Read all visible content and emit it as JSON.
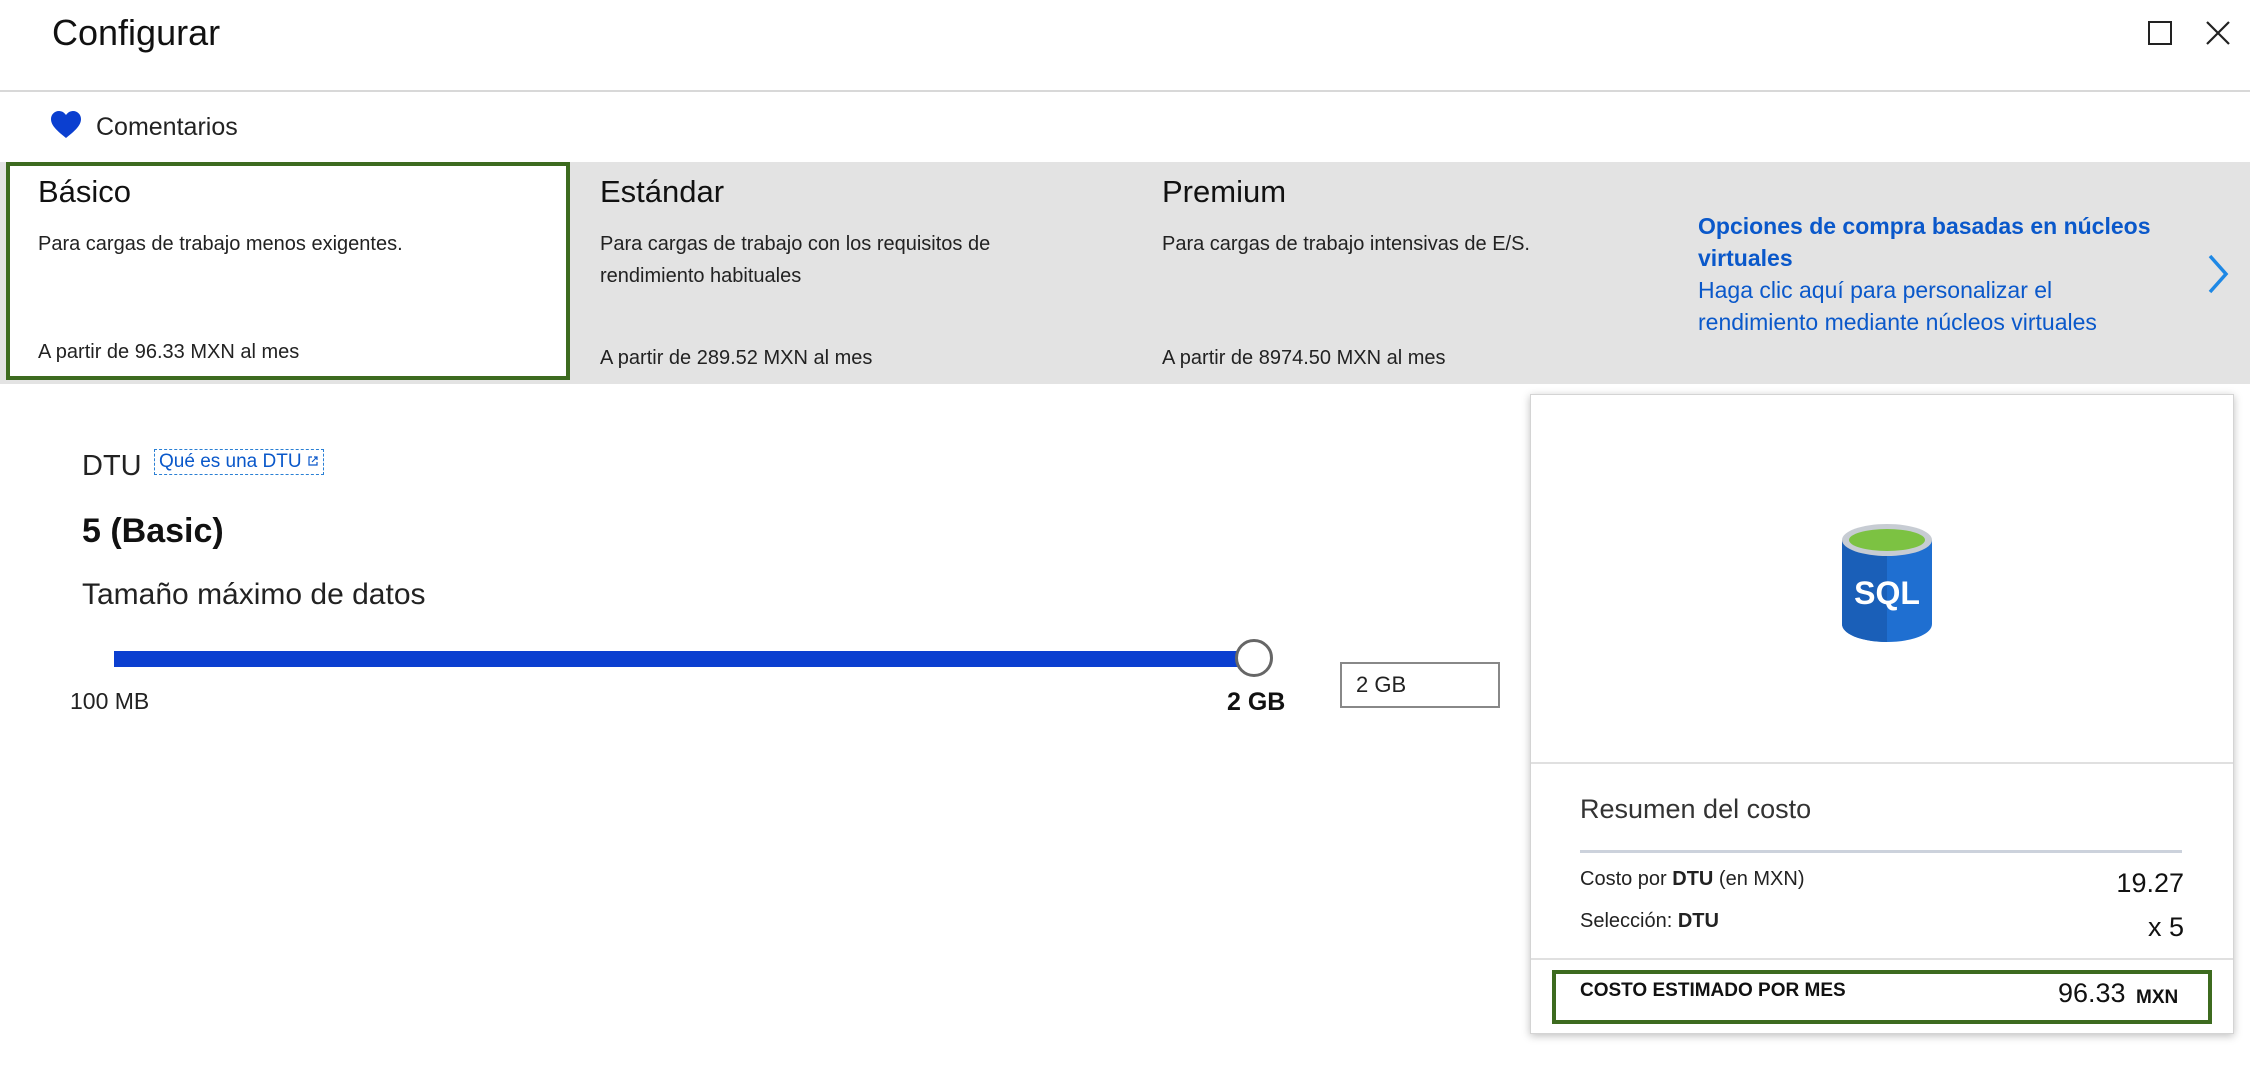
{
  "header": {
    "title": "Configurar",
    "maximize_icon": "maximize-icon",
    "close_icon": "close-icon"
  },
  "feedback": {
    "label": "Comentarios",
    "icon": "heart-icon",
    "icon_color": "#0b3fd0"
  },
  "tiers": [
    {
      "name": "Básico",
      "description": "Para cargas de trabajo menos exigentes.",
      "price": "A partir de 96.33 MXN al mes",
      "selected": true
    },
    {
      "name": "Estándar",
      "description": "Para cargas de trabajo con los requisitos de rendimiento habituales",
      "price": "A partir de 289.52 MXN al mes",
      "selected": false
    },
    {
      "name": "Premium",
      "description": "Para cargas de trabajo intensivas de E/S.",
      "price": "A partir de 8974.50 MXN al mes",
      "selected": false
    }
  ],
  "vcore": {
    "title": "Opciones de compra basadas en núcleos virtuales",
    "description": "Haga clic aquí para personalizar el rendimiento mediante núcleos virtuales",
    "icon": "chevron-right-icon"
  },
  "dtu": {
    "label": "DTU",
    "link": "Qué es una DTU",
    "value": "5 (Basic)"
  },
  "max_size": {
    "label": "Tamaño máximo de datos",
    "min_label": "100 MB",
    "max_label": "2 GB",
    "input_value": "2 GB",
    "slider_fraction": 1.0
  },
  "cost_summary": {
    "icon": "sql-database-icon",
    "icon_text": "SQL",
    "title": "Resumen del costo",
    "rows": [
      {
        "label_prefix": "Costo por ",
        "label_bold": "DTU",
        "label_suffix": " (en MXN)",
        "value": "19.27"
      },
      {
        "label_prefix": "Selección: ",
        "label_bold": "DTU",
        "label_suffix": "",
        "value": "x 5"
      }
    ],
    "total_label": "COSTO ESTIMADO POR MES",
    "total_value": "96.33",
    "total_currency": "MXN"
  },
  "colors": {
    "accent": "#0a58ca",
    "selection_border": "#3d6b1f",
    "slider": "#0b3fd0"
  }
}
